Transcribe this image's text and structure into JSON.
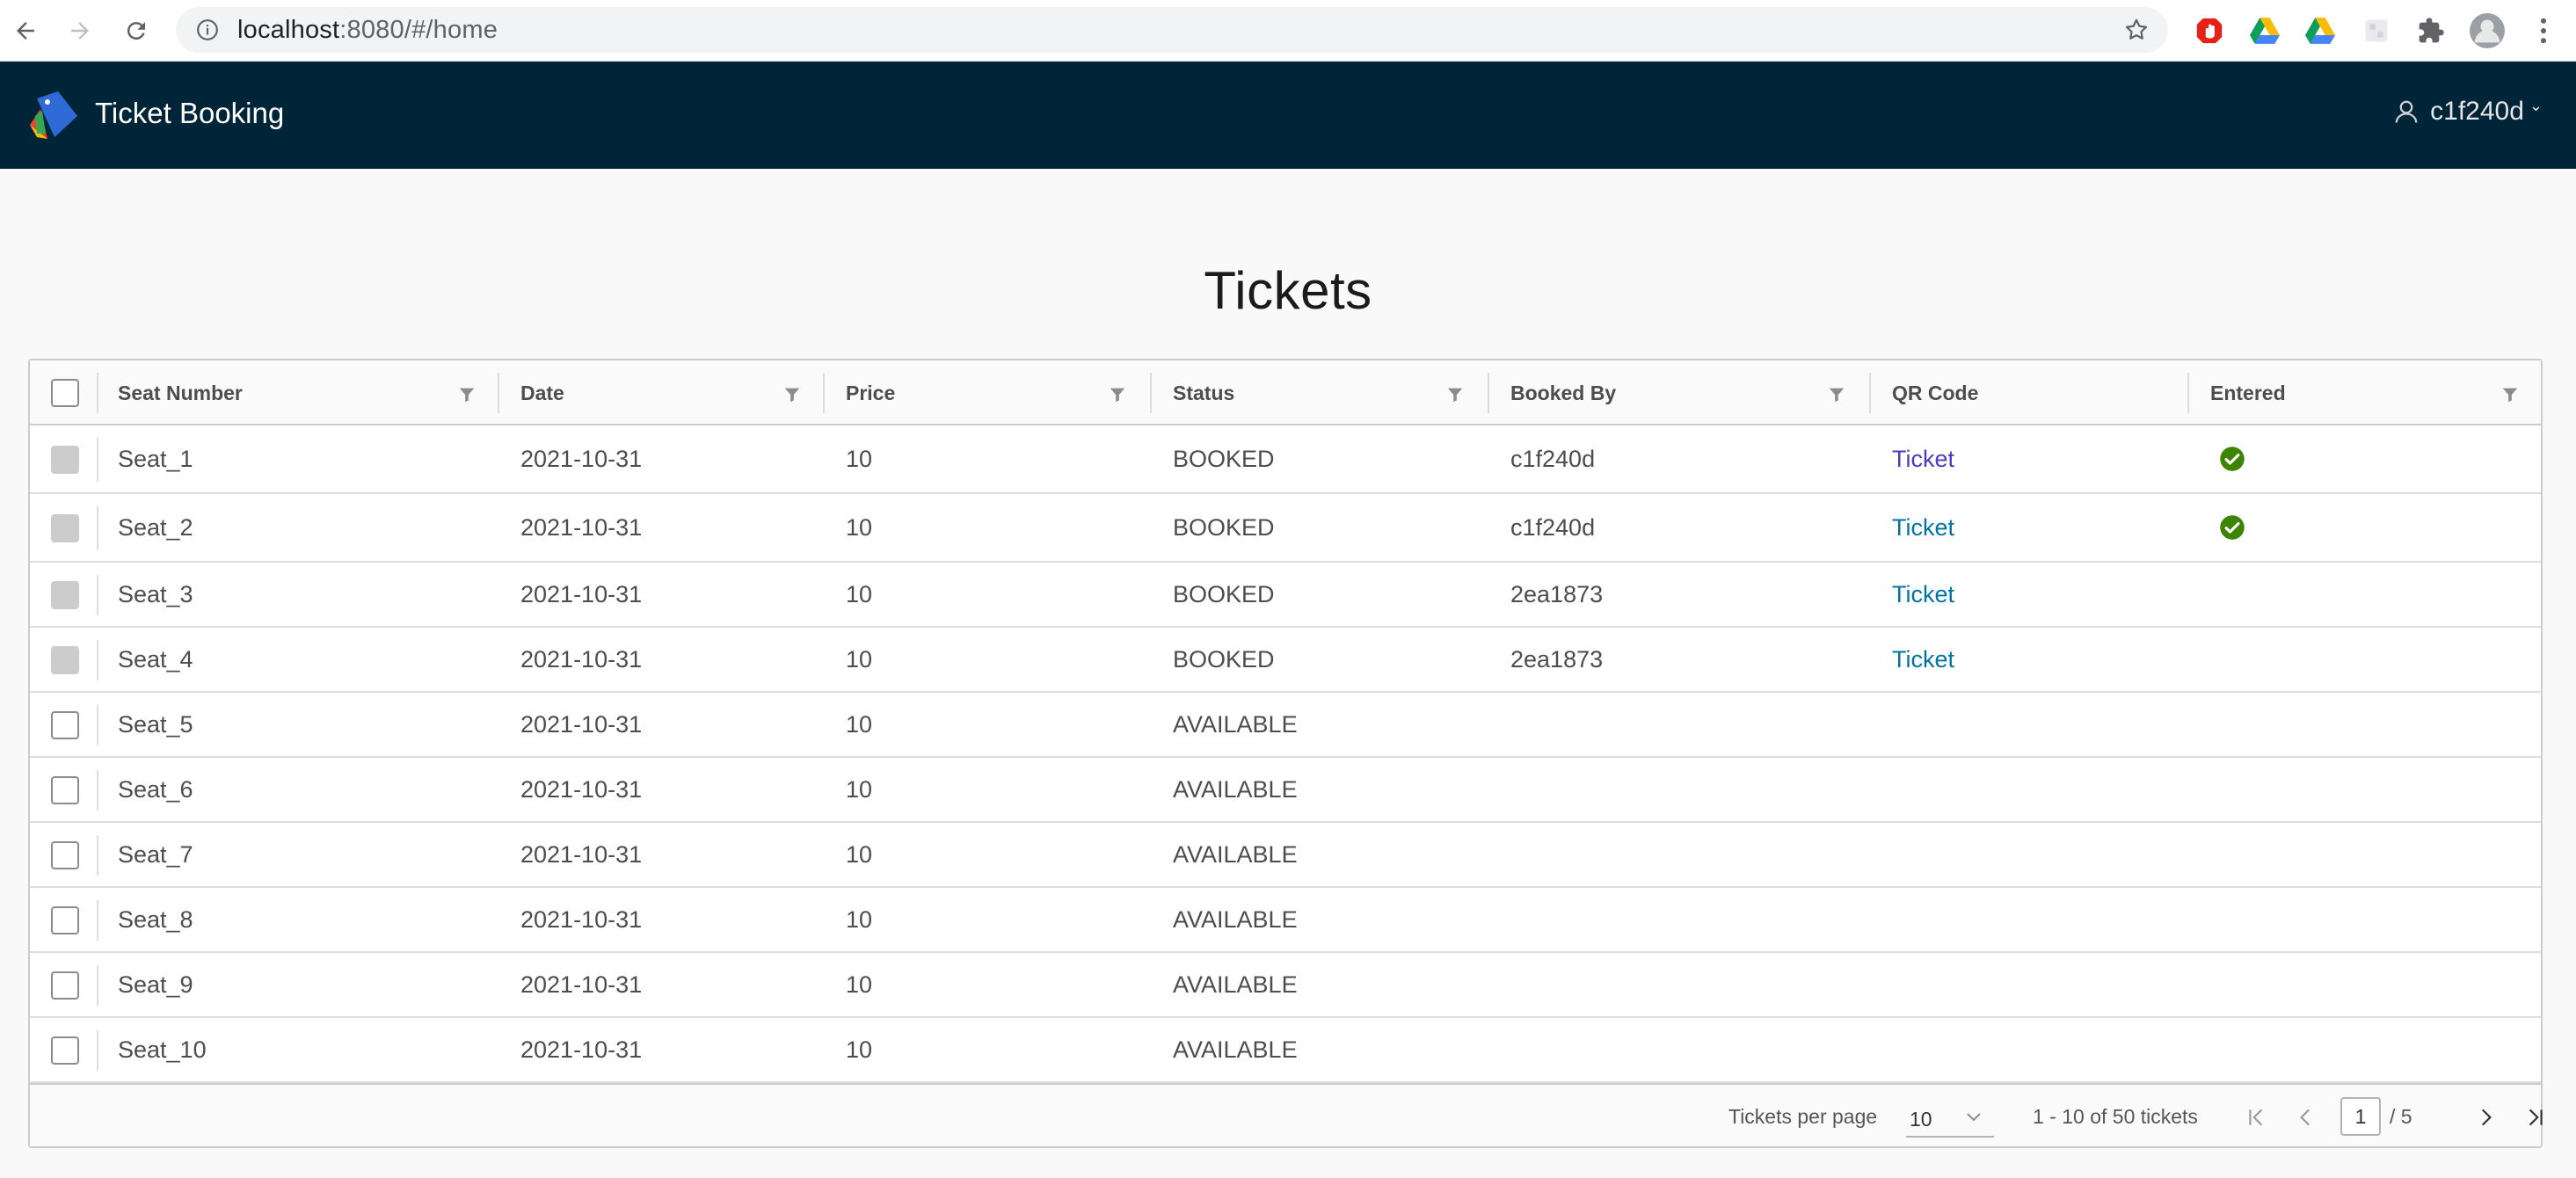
{
  "browser": {
    "url_host": "localhost",
    "url_rest": ":8080/#/home"
  },
  "app": {
    "title": "Ticket Booking",
    "user": "c1f240d",
    "header_color": "#002538"
  },
  "page": {
    "title": "Tickets"
  },
  "table": {
    "columns": [
      "Seat Number",
      "Date",
      "Price",
      "Status",
      "Booked By",
      "QR Code",
      "Entered"
    ],
    "rows": [
      {
        "seat": "Seat_1",
        "date": "2021-10-31",
        "price": "10",
        "status": "BOOKED",
        "booked_by": "c1f240d",
        "qr": "Ticket",
        "entered": true,
        "selectable": false
      },
      {
        "seat": "Seat_2",
        "date": "2021-10-31",
        "price": "10",
        "status": "BOOKED",
        "booked_by": "c1f240d",
        "qr": "Ticket",
        "entered": true,
        "selectable": false
      },
      {
        "seat": "Seat_3",
        "date": "2021-10-31",
        "price": "10",
        "status": "BOOKED",
        "booked_by": "2ea1873",
        "qr": "Ticket",
        "entered": false,
        "selectable": false
      },
      {
        "seat": "Seat_4",
        "date": "2021-10-31",
        "price": "10",
        "status": "BOOKED",
        "booked_by": "2ea1873",
        "qr": "Ticket",
        "entered": false,
        "selectable": false
      },
      {
        "seat": "Seat_5",
        "date": "2021-10-31",
        "price": "10",
        "status": "AVAILABLE",
        "booked_by": "",
        "qr": "",
        "entered": false,
        "selectable": true
      },
      {
        "seat": "Seat_6",
        "date": "2021-10-31",
        "price": "10",
        "status": "AVAILABLE",
        "booked_by": "",
        "qr": "",
        "entered": false,
        "selectable": true
      },
      {
        "seat": "Seat_7",
        "date": "2021-10-31",
        "price": "10",
        "status": "AVAILABLE",
        "booked_by": "",
        "qr": "",
        "entered": false,
        "selectable": true
      },
      {
        "seat": "Seat_8",
        "date": "2021-10-31",
        "price": "10",
        "status": "AVAILABLE",
        "booked_by": "",
        "qr": "",
        "entered": false,
        "selectable": true
      },
      {
        "seat": "Seat_9",
        "date": "2021-10-31",
        "price": "10",
        "status": "AVAILABLE",
        "booked_by": "",
        "qr": "",
        "entered": false,
        "selectable": true
      },
      {
        "seat": "Seat_10",
        "date": "2021-10-31",
        "price": "10",
        "status": "AVAILABLE",
        "booked_by": "",
        "qr": "",
        "entered": false,
        "selectable": true
      }
    ]
  },
  "footer": {
    "per_page_label": "Tickets per page",
    "per_page_value": "10",
    "range_text": "1 - 10 of 50 tickets",
    "current_page": "1",
    "total_pages": "/ 5"
  },
  "colors": {
    "link": "#0072a3",
    "entered_check": "#3c8500"
  }
}
